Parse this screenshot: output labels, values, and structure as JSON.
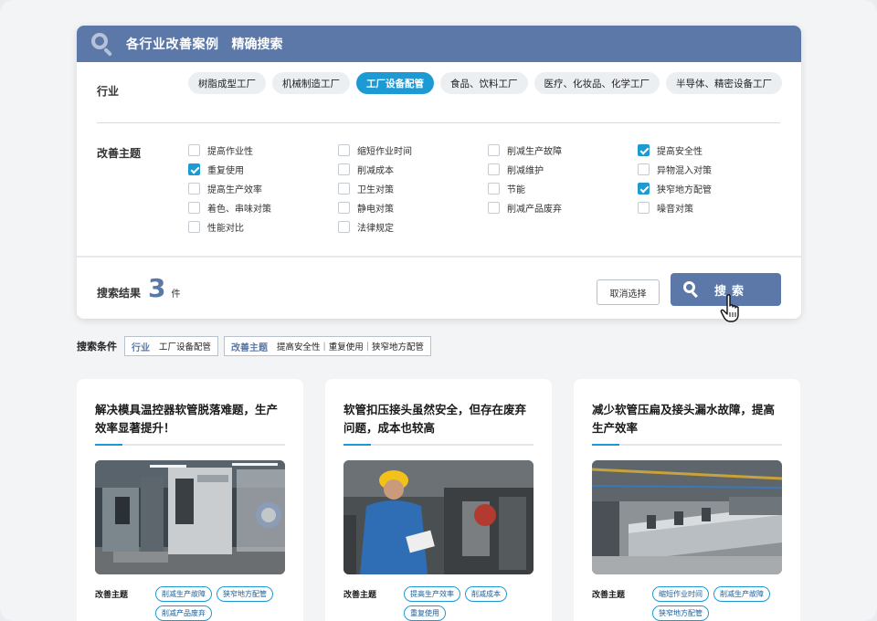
{
  "header": {
    "title": "各行业改善案例",
    "subtitle": "精确搜索"
  },
  "industry": {
    "label": "行业",
    "chips": [
      {
        "label": "树脂成型工厂",
        "active": false
      },
      {
        "label": "机械制造工厂",
        "active": false
      },
      {
        "label": "工厂设备配管",
        "active": true
      },
      {
        "label": "食品、饮料工厂",
        "active": false
      },
      {
        "label": "医疗、化妆品、化学工厂",
        "active": false
      },
      {
        "label": "半导体、精密设备工厂",
        "active": false
      }
    ]
  },
  "topics": {
    "label": "改善主题",
    "columns": [
      [
        {
          "label": "提高作业性",
          "checked": false
        },
        {
          "label": "重复使用",
          "checked": true
        },
        {
          "label": "提高生产效率",
          "checked": false
        },
        {
          "label": "着色、串味对策",
          "checked": false
        },
        {
          "label": "性能对比",
          "checked": false
        }
      ],
      [
        {
          "label": "缩短作业时间",
          "checked": false
        },
        {
          "label": "削减成本",
          "checked": false
        },
        {
          "label": "卫生对策",
          "checked": false
        },
        {
          "label": "静电对策",
          "checked": false
        },
        {
          "label": "法律规定",
          "checked": false
        }
      ],
      [
        {
          "label": "削减生产故障",
          "checked": false
        },
        {
          "label": "削减维护",
          "checked": false
        },
        {
          "label": "节能",
          "checked": false
        },
        {
          "label": "削减产品废弃",
          "checked": false
        }
      ],
      [
        {
          "label": "提高安全性",
          "checked": true
        },
        {
          "label": "异物混入对策",
          "checked": false
        },
        {
          "label": "狭窄地方配管",
          "checked": true
        },
        {
          "label": "噪音对策",
          "checked": false
        }
      ]
    ]
  },
  "result": {
    "label": "搜索结果",
    "count": "3",
    "unit": "件"
  },
  "buttons": {
    "clear": "取消选择",
    "search": "搜索"
  },
  "conditions": {
    "label": "搜索条件",
    "industry_key": "行业",
    "industry_value": "工厂设备配管",
    "topic_key": "改善主题",
    "topic_values": [
      "提高安全性",
      "重复使用",
      "狭窄地方配管"
    ]
  },
  "cards": [
    {
      "title": "解决模具温控器软管脱落难题，生产效率显著提升！",
      "topic_label": "改善主题",
      "tags": [
        "削减生产故障",
        "狭窄地方配管",
        "削减产品废弃"
      ]
    },
    {
      "title": "软管扣压接头虽然安全，但存在废弃问题，成本也较高",
      "topic_label": "改善主题",
      "tags": [
        "提高生产效率",
        "削减成本",
        "重复使用"
      ]
    },
    {
      "title": "减少软管压扁及接头漏水故障，提高生产效率",
      "topic_label": "改善主题",
      "tags": [
        "缩短作业时间",
        "削减生产故障",
        "狭窄地方配管"
      ]
    }
  ],
  "colors": {
    "header": "#5b78a9",
    "accent": "#1d9ad3"
  }
}
